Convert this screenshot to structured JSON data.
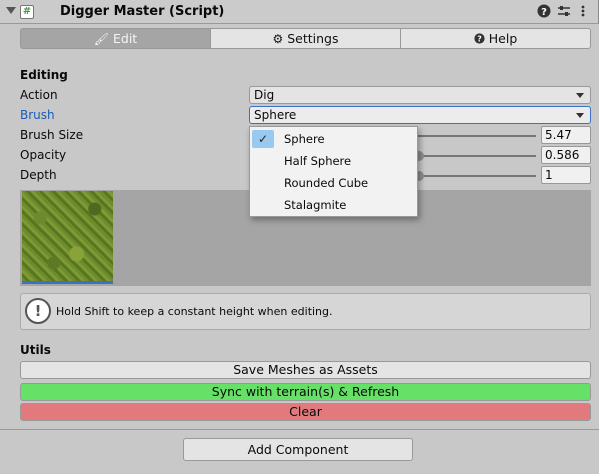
{
  "component": {
    "title": "Digger Master (Script)",
    "script_icon": "#",
    "icons": [
      "help-icon",
      "preset-icon",
      "menu-icon"
    ]
  },
  "tabs": [
    {
      "label": "Edit",
      "icon": "brush-icon",
      "active": true
    },
    {
      "label": "Settings",
      "icon": "gear-icon",
      "active": false
    },
    {
      "label": "Help",
      "icon": "help-icon",
      "active": false
    }
  ],
  "editing": {
    "section_label": "Editing",
    "action": {
      "label": "Action",
      "value": "Dig"
    },
    "brush": {
      "label": "Brush",
      "value": "Sphere"
    },
    "brush_size": {
      "label": "Brush Size",
      "value": "5.47"
    },
    "opacity": {
      "label": "Opacity",
      "value": "0.586"
    },
    "depth": {
      "label": "Depth",
      "value": "1"
    }
  },
  "brush_popup": {
    "options": [
      "Sphere",
      "Half Sphere",
      "Rounded Cube",
      "Stalagmite"
    ],
    "selected": "Sphere"
  },
  "help_box": {
    "text": "Hold Shift to keep a constant height when editing."
  },
  "utils": {
    "section_label": "Utils",
    "save_meshes": "Save Meshes as Assets",
    "sync": "Sync with terrain(s) & Refresh",
    "clear": "Clear"
  },
  "footer": {
    "add_component": "Add Component"
  },
  "colors": {
    "accent": "#3a72c8",
    "sync_button": "#66e067",
    "clear_button": "#e27a7d"
  }
}
